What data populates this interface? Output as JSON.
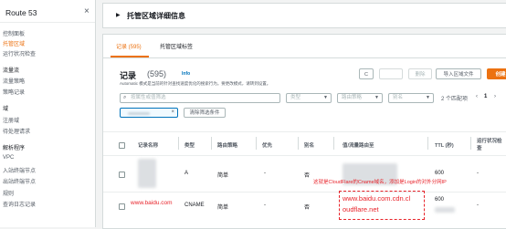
{
  "sidebar": {
    "title": "Route 53",
    "close_icon": "×",
    "items": [
      {
        "label": "控制面板",
        "active": false,
        "head": false
      },
      {
        "label": "托管区域",
        "active": true,
        "head": false
      },
      {
        "label": "运行状况检查",
        "active": false,
        "head": false
      },
      {
        "label": "流量流",
        "active": false,
        "head": true
      },
      {
        "label": "流量策略",
        "active": false,
        "head": false
      },
      {
        "label": "策略记录",
        "active": false,
        "head": false
      },
      {
        "label": "域",
        "active": false,
        "head": true
      },
      {
        "label": "注册域",
        "active": false,
        "head": false
      },
      {
        "label": "待处理请求",
        "active": false,
        "head": false
      },
      {
        "label": "解析程序",
        "active": false,
        "head": true
      },
      {
        "label": "VPC",
        "active": false,
        "head": false
      },
      {
        "label": "入站终端节点",
        "active": false,
        "head": false
      },
      {
        "label": "出站终端节点",
        "active": false,
        "head": false
      },
      {
        "label": "规则",
        "active": false,
        "head": false
      },
      {
        "label": "查询日志记录",
        "active": false,
        "head": false
      }
    ]
  },
  "details": {
    "label": "托管区域详细信息"
  },
  "tabs": [
    {
      "label": "记录 (595)",
      "active": true
    },
    {
      "label": "托管区域标签",
      "active": false
    }
  ],
  "records": {
    "title": "记录",
    "count": "(595)",
    "info": "Info",
    "subtitle": "Automatic 模式是当前的针对查找速度优化的搜索行为。要更改模式，请转到设置。",
    "buttons": {
      "refresh_icon": "C",
      "delete": "删除",
      "import": "导入区域文件",
      "create": "创建"
    },
    "search_placeholder": "按属性或值筛选",
    "type_placeholder": "类型",
    "policy_placeholder": "路由策略",
    "alias_placeholder": "别名",
    "match_count": "2 个匹配项",
    "page_number": "1",
    "clear_filters": "清除筛选条件",
    "columns": [
      "记录名称",
      "类型",
      "路由策略",
      "优先",
      "别名",
      "值/流量路由至",
      "TTL (秒)",
      "运行状况检查"
    ],
    "rows": [
      {
        "name": "",
        "type": "A",
        "policy": "简单",
        "diff": "-",
        "alias": "否",
        "value": "",
        "ttl": "600",
        "health": "-"
      },
      {
        "name": "www.baidu.com",
        "type": "CNAME",
        "policy": "简单",
        "diff": "-",
        "alias": "否",
        "value": "www.baidu.com.cdn.cloudflare.net",
        "ttl": "600",
        "health": "-"
      }
    ],
    "annotation": "这就是CloudFlare的Cname域名，添加是Login的对外分网IP",
    "value_line1": "www.baidu.com.cdn.cl",
    "value_line2": "oudflare.net"
  },
  "colors": {
    "accent": "#ec7211",
    "annotation": "#e8232a",
    "link": "#0073bb"
  }
}
